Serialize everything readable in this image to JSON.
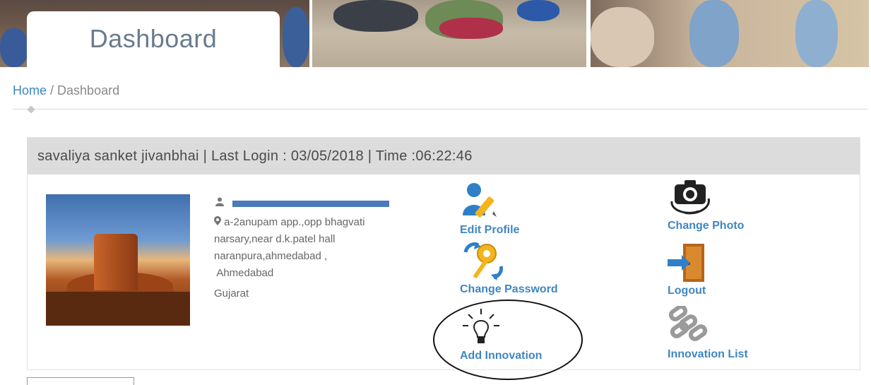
{
  "header": {
    "title": "Dashboard"
  },
  "breadcrumb": {
    "home": "Home",
    "separator": " / ",
    "current": "Dashboard"
  },
  "panel": {
    "heading": "savaliya sanket jivanbhai | Last Login : 03/05/2018 | Time :06:22:46"
  },
  "profile": {
    "address_lines": [
      "a-2anupam app.,opp bhagvati",
      "narsary,near d.k.patel hall",
      "naranpura,ahmedabad ,",
      " Ahmedabad"
    ],
    "state": "Gujarat"
  },
  "actions": {
    "edit_profile": "Edit Profile",
    "change_photo": "Change Photo",
    "change_password": "Change Password",
    "logout": "Logout",
    "add_innovation": "Add Innovation",
    "innovation_list": "Innovation List"
  },
  "icons": {
    "user": "user-icon",
    "location": "map-marker-icon",
    "edit_profile": "user-edit-icon",
    "change_photo": "camera-icon",
    "change_password": "key-icon",
    "logout": "door-exit-icon",
    "add_innovation": "lightbulb-icon",
    "innovation_list": "chain-links-icon"
  },
  "colors": {
    "link": "#3f86c1",
    "header_bg": "#dcdcdc",
    "name_bar": "#4a7ab8"
  }
}
